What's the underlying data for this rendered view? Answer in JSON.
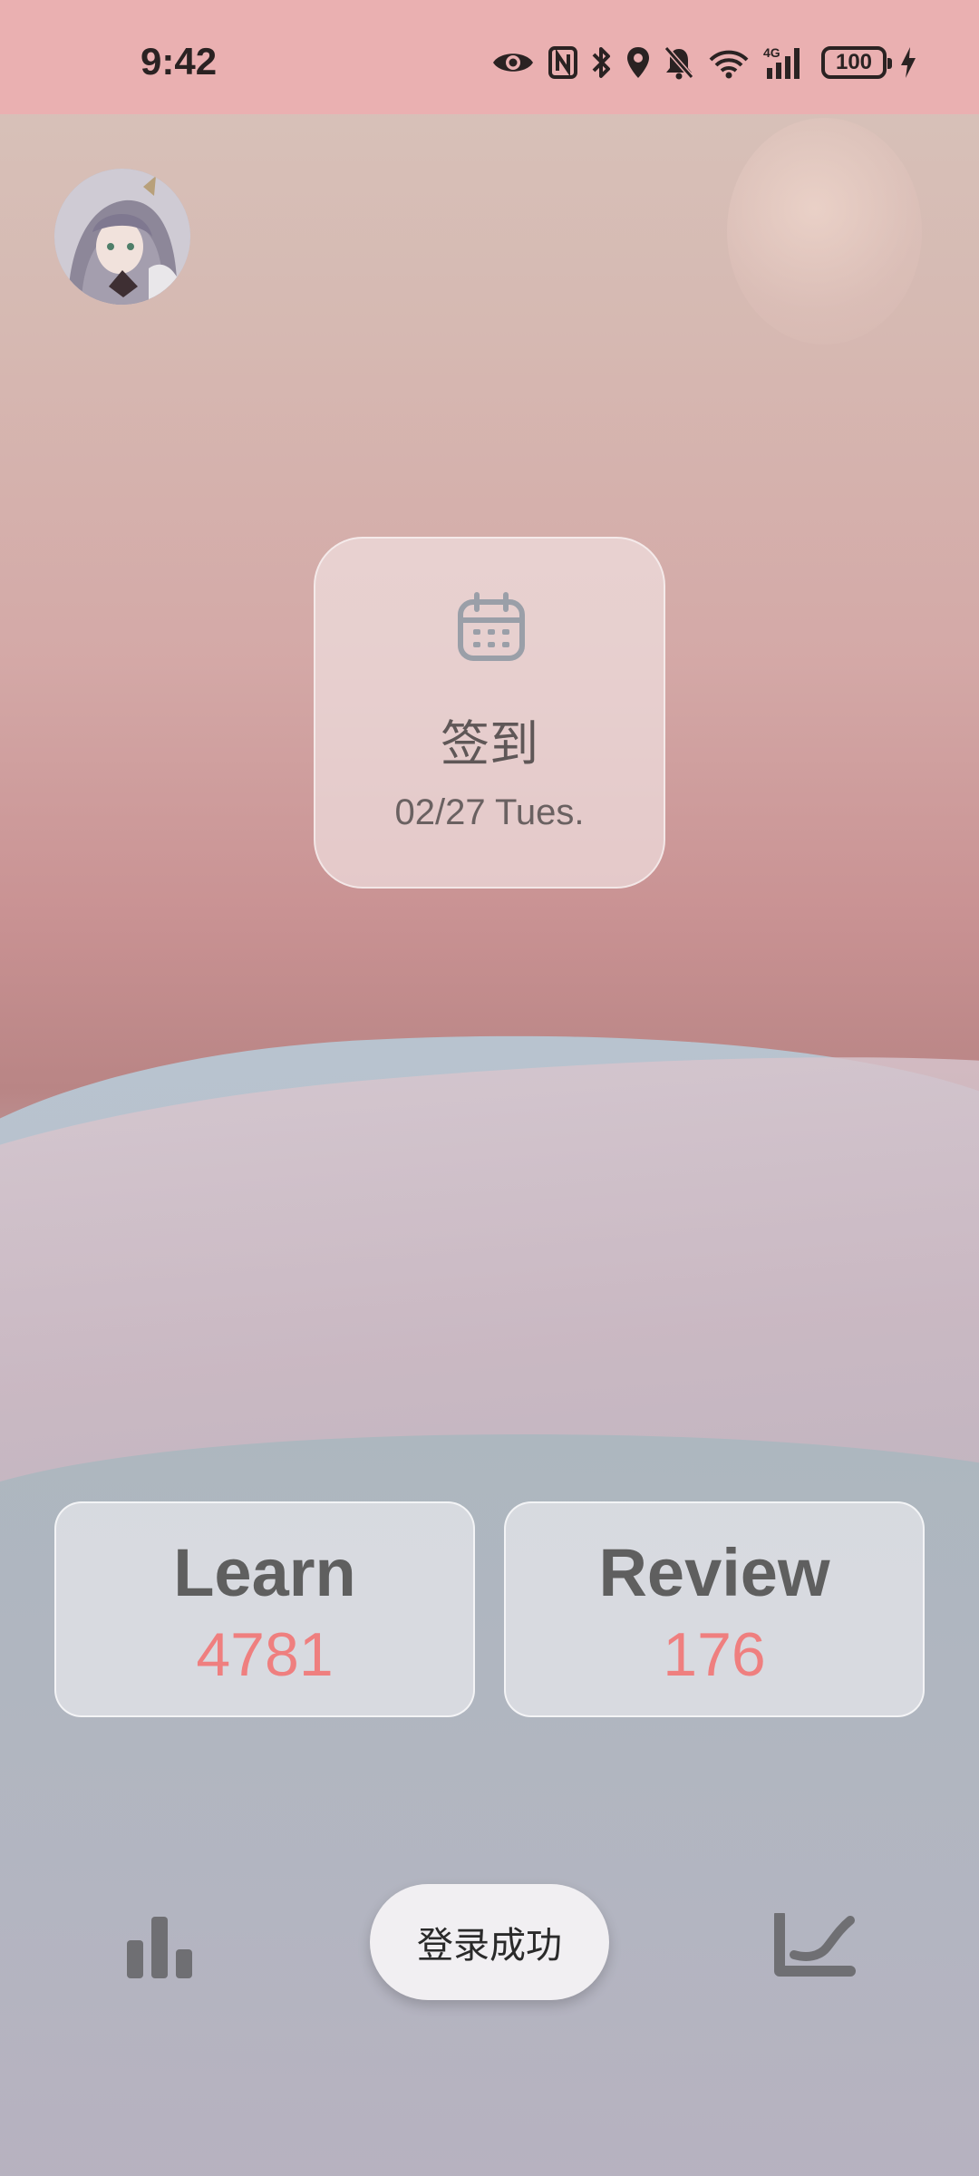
{
  "status_bar": {
    "time": "9:42",
    "battery": "100",
    "network": "4G",
    "icons": [
      "eye-icon",
      "nfc-icon",
      "bluetooth-icon",
      "location-icon",
      "bell-off-icon",
      "wifi-icon",
      "signal-icon",
      "battery-icon",
      "charging-icon"
    ]
  },
  "profile": {
    "avatar_icon": "avatar"
  },
  "checkin": {
    "icon": "calendar-icon",
    "title": "签到",
    "date": "02/27 Tues."
  },
  "stats": {
    "learn": {
      "label": "Learn",
      "value": "4781"
    },
    "review": {
      "label": "Review",
      "value": "176"
    }
  },
  "bottom_bar": {
    "left_icon": "bar-chart-icon",
    "right_icon": "curve-chart-icon",
    "toast": "登录成功"
  },
  "colors": {
    "status_bar_bg": "#eab0b1",
    "accent_number": "#ef7f7f",
    "label_text": "#5f5f5f"
  }
}
